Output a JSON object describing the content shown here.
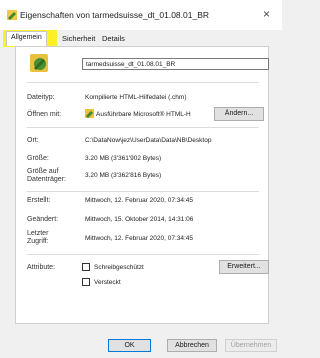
{
  "window": {
    "title": "Eigenschaften von tarmedsuisse_dt_01.08.01_BR",
    "close_glyph": "×"
  },
  "tabs": [
    {
      "label": "Allgemein",
      "active": true
    },
    {
      "label": "Sicherheit",
      "active": false
    },
    {
      "label": "Details",
      "active": false
    }
  ],
  "file": {
    "name": "tarmedsuisse_dt_01.08.01_BR"
  },
  "rows": {
    "type_label": "Dateityp:",
    "type_value": "Kompilierte HTML-Hilfedatei (.chm)",
    "open_label": "Öffnen mit:",
    "open_value": "Ausführbare Microsoft® HTML-H",
    "change_button": "Ändern...",
    "location_label": "Ort:",
    "location_value": "C:\\DataNow\\jez\\UserData\\Data\\NB\\Desktop",
    "size_label": "Größe:",
    "size_value": "3.20 MB (3'361'902 Bytes)",
    "disk_size_label": "Größe auf Datenträger:",
    "disk_size_value": "3.20 MB (3'362'816 Bytes)",
    "created_label": "Erstellt:",
    "created_value": "Mittwoch, 12. Februar 2020, 07:34:45",
    "modified_label": "Geändert:",
    "modified_value": "Mittwoch, 15. Oktober 2014, 14:31:06",
    "accessed_label": "Letzter Zugriff:",
    "accessed_value": "Mittwoch, 12. Februar 2020, 07:34:45",
    "attributes_label": "Attribute:",
    "readonly_label": "Schreibgeschützt",
    "hidden_label": "Versteckt",
    "advanced_button": "Erweitert..."
  },
  "footer": {
    "ok": "OK",
    "cancel": "Abbrechen",
    "apply": "Übernehmen"
  },
  "colors": {
    "highlight": "#fff000",
    "default_button_border": "#0078d7"
  }
}
